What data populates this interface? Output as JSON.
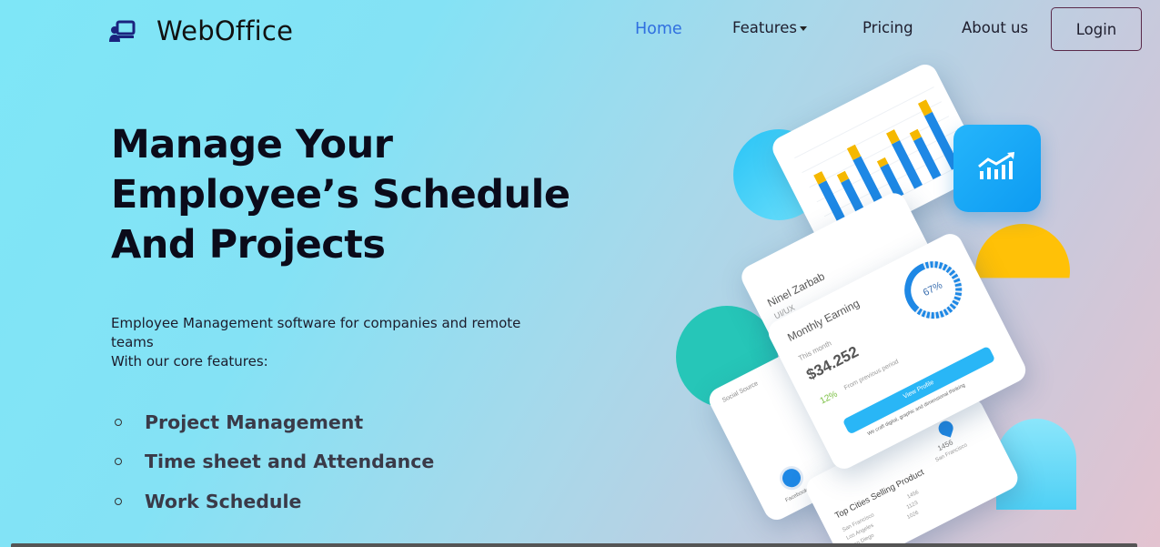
{
  "nav": {
    "brand": "WebOffice",
    "links": [
      "Home",
      "Features",
      "Pricing",
      "About us"
    ],
    "login": "Login"
  },
  "hero": {
    "title_lines": [
      "Manage Your",
      "Employee’s Schedule",
      "And Projects"
    ],
    "desc_lines": [
      "Employee Management software for companies and remote",
      "teams",
      "With our core features:"
    ],
    "features": [
      "Project Management",
      "Time sheet and Attendance",
      "Work Schedule"
    ]
  },
  "illustration": {
    "profile_name": "Ninel Zarbab",
    "profile_role": "UI/UX",
    "earning_title": "Monthly Earning",
    "earning_period": "This month",
    "earning_value": "$34.252",
    "earning_change": "12%",
    "earning_change_label": "From previous period",
    "gauge_percent": "67%",
    "gauge_value": 0.67,
    "view_profile": "View Profile",
    "tagline": "We craft digital, graphic and dimensional thinking",
    "social_title": "Social Source",
    "cities_title": "Top Cities Selling Product",
    "city_value": "1456",
    "city_name": "San Francisco",
    "social_item": "Facebook",
    "cities": [
      {
        "name": "San Francisco",
        "value": "1456"
      },
      {
        "name": "Los Angeles",
        "value": "1123"
      },
      {
        "name": "San Diego",
        "value": "1026"
      }
    ]
  },
  "colors": {
    "accent": "#2f6fe0",
    "blue": "#1e88e5",
    "yellow": "#f5b800",
    "cyan": "#29b6f6",
    "teal": "#26c6b8"
  }
}
